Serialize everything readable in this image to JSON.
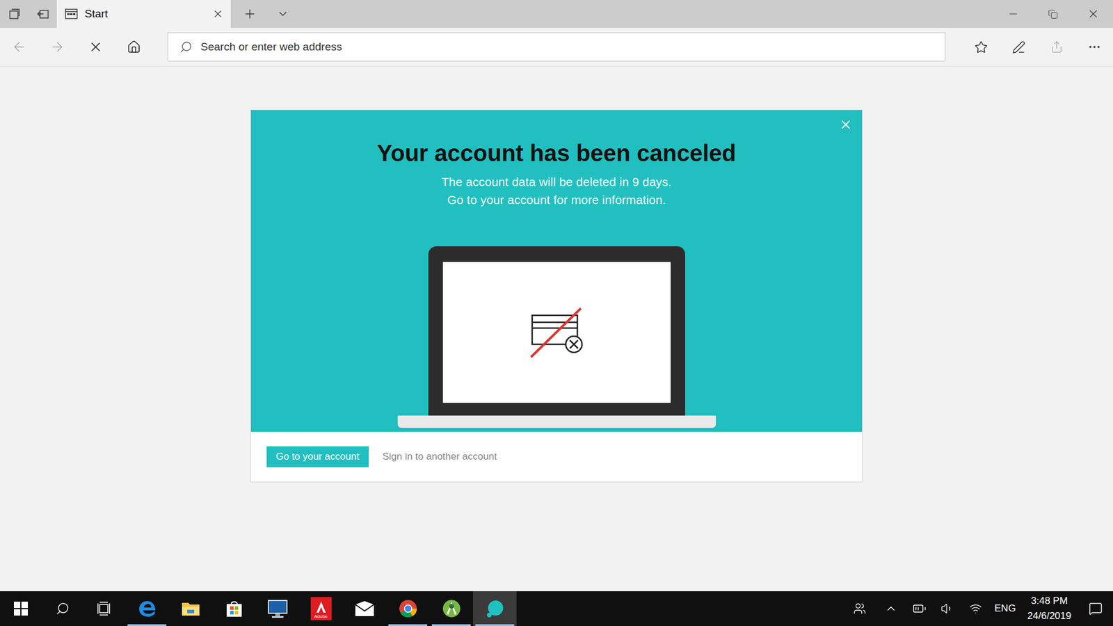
{
  "browser": {
    "tab": {
      "label": "Start",
      "selected": true
    },
    "address": {
      "placeholder": "Search or enter web address"
    },
    "loading": true,
    "back_enabled": false,
    "forward_enabled": false,
    "share_enabled": false
  },
  "dialog": {
    "title": "Your account has been canceled",
    "lines": [
      "The account data will be deleted in 9 days.",
      "Go to your account for more information."
    ],
    "primary_button": "Go to your account",
    "secondary_link": "Sign in to another account"
  },
  "taskbar": {
    "apps": [
      {
        "kind": "edge",
        "running": true,
        "active": false
      },
      {
        "kind": "explorer",
        "running": false,
        "active": false
      },
      {
        "kind": "store",
        "running": false,
        "active": false
      },
      {
        "kind": "monitor",
        "running": false,
        "active": false
      },
      {
        "kind": "adobe",
        "label": "Adobe",
        "running": false,
        "active": false
      },
      {
        "kind": "mail",
        "running": false,
        "active": false
      },
      {
        "kind": "chrome",
        "running": true,
        "active": false
      },
      {
        "kind": "android-studio",
        "running": true,
        "active": false
      },
      {
        "kind": "teal",
        "running": true,
        "active": true
      }
    ],
    "language": "ENG",
    "time": "3:48 PM",
    "date": "24/6/2019"
  }
}
